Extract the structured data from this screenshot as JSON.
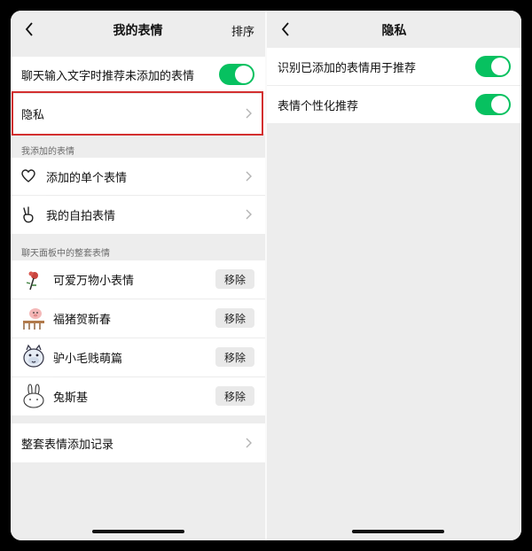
{
  "left": {
    "nav": {
      "title": "我的表情",
      "sort_label": "排序"
    },
    "recommend_row": {
      "label": "聊天输入文字时推荐未添加的表情",
      "on": true
    },
    "privacy_row": {
      "label": "隐私"
    },
    "section_added": {
      "label": "我添加的表情"
    },
    "added_items": [
      {
        "label": "添加的单个表情",
        "icon": "heart-icon"
      },
      {
        "label": "我的自拍表情",
        "icon": "peace-hand-icon"
      }
    ],
    "section_sets": {
      "label": "聊天面板中的整套表情"
    },
    "sets": [
      {
        "label": "可爱万物小表情",
        "button": "移除"
      },
      {
        "label": "福猪贺新春",
        "button": "移除"
      },
      {
        "label": "驴小毛贱萌篇",
        "button": "移除"
      },
      {
        "label": "兔斯基",
        "button": "移除"
      }
    ],
    "history_row": {
      "label": "整套表情添加记录"
    }
  },
  "right": {
    "nav": {
      "title": "隐私"
    },
    "rows": [
      {
        "label": "识别已添加的表情用于推荐",
        "on": true
      },
      {
        "label": "表情个性化推荐",
        "on": true
      }
    ]
  },
  "colors": {
    "toggle_on": "#07c160",
    "highlight": "#d32f2f",
    "background": "#ededed"
  }
}
